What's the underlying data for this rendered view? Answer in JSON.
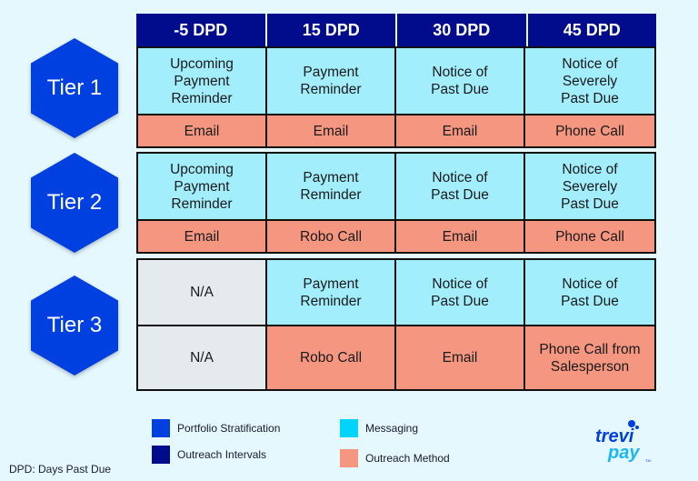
{
  "header": {
    "columns": [
      "-5 DPD",
      "15 DPD",
      "30 DPD",
      "45 DPD"
    ]
  },
  "tiers": [
    {
      "label": "Tier 1",
      "messaging": [
        "Upcoming\nPayment\nReminder",
        "Payment\nReminder",
        "Notice of\nPast Due",
        "Notice of\nSeverely\nPast Due"
      ],
      "method": [
        "Email",
        "Email",
        "Email",
        "Phone Call"
      ]
    },
    {
      "label": "Tier 2",
      "messaging": [
        "Upcoming\nPayment\nReminder",
        "Payment\nReminder",
        "Notice of\nPast Due",
        "Notice of\nSeverely\nPast Due"
      ],
      "method": [
        "Email",
        "Robo Call",
        "Email",
        "Phone Call"
      ]
    },
    {
      "label": "Tier 3",
      "messaging": [
        "N/A",
        "Payment\nReminder",
        "Notice of\nPast Due",
        "Notice of\nPast Due"
      ],
      "method": [
        "N/A",
        "Robo Call",
        "Email",
        "Phone Call from\nSalesperson"
      ]
    }
  ],
  "legend": [
    {
      "label": "Portfolio Stratification",
      "color": "#0040e0"
    },
    {
      "label": "Outreach Intervals",
      "color": "#000c8c"
    },
    {
      "label": "Messaging",
      "color": "#00d4fa"
    },
    {
      "label": "Outreach Method",
      "color": "#f59680"
    }
  ],
  "colors": {
    "header": "#000c8c",
    "tier": "#0040e0",
    "messaging": "#a2eefc",
    "method": "#f59680",
    "na": "#e5eaee",
    "background": "#e4f8fe"
  },
  "footnote": "DPD: Days Past Due",
  "logo": {
    "line1": "trevi",
    "line2": "pay",
    "mark": "TM"
  }
}
